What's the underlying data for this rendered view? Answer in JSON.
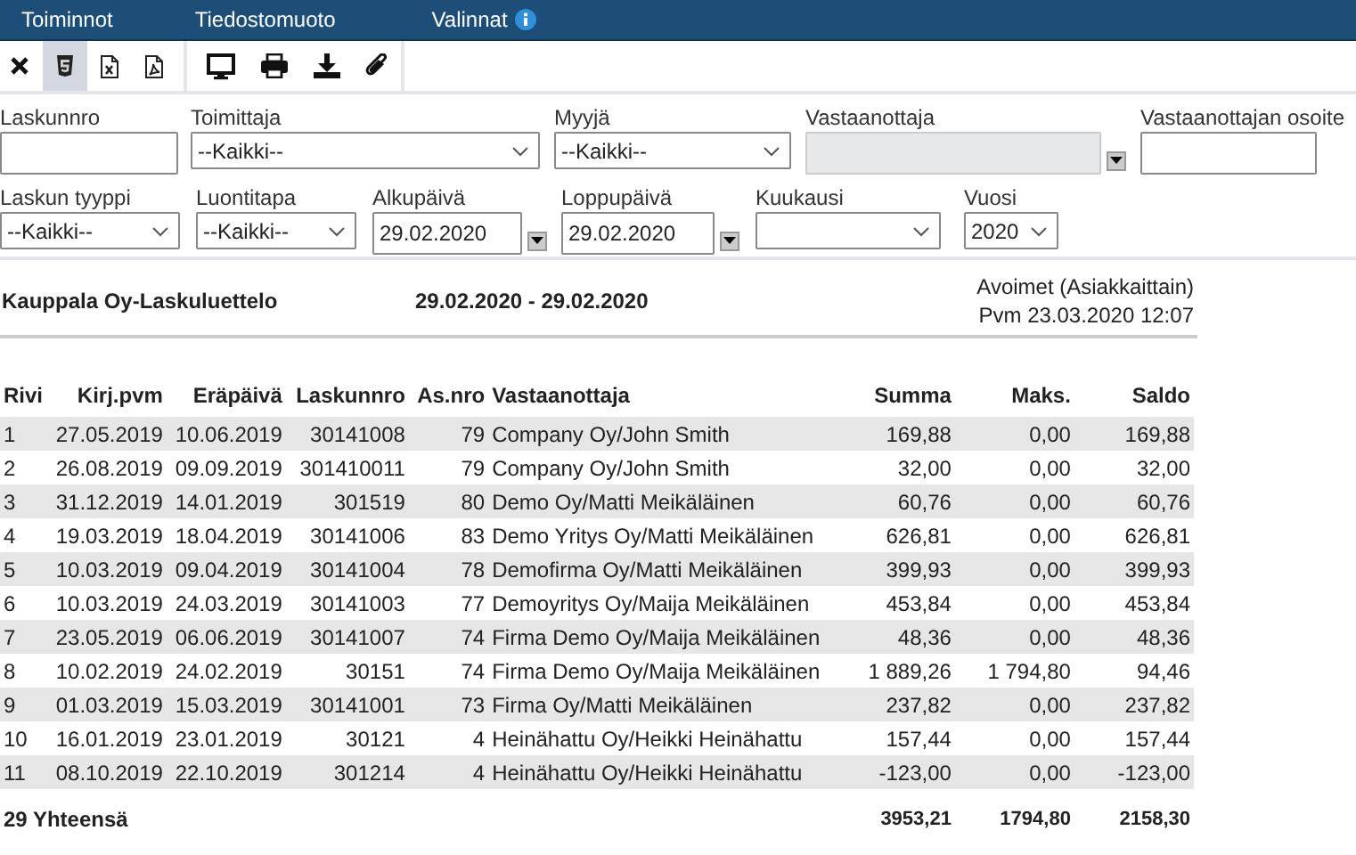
{
  "menu": [
    {
      "label": "Toiminnot",
      "info": false
    },
    {
      "label": "Tiedostomuoto",
      "info": false
    },
    {
      "label": "Valinnat",
      "info": true
    }
  ],
  "toolbar": [
    {
      "kind": "close",
      "selected": false
    },
    {
      "kind": "html",
      "selected": true
    },
    {
      "kind": "excel",
      "selected": false
    },
    {
      "kind": "pdf",
      "selected": false
    },
    {
      "kind": "separator"
    },
    {
      "kind": "monitor",
      "selected": false
    },
    {
      "kind": "print",
      "selected": false
    },
    {
      "kind": "download",
      "selected": false
    },
    {
      "kind": "attach",
      "selected": false
    }
  ],
  "filter_rows": [
    [
      {
        "label": "Laskunnro",
        "kind": "text",
        "disabled": false
      },
      {
        "label": "Toimittaja",
        "kind": "select",
        "value": "--Kaikki--",
        "disabled": false
      },
      {
        "label": "Myyjä",
        "kind": "select",
        "value": "--Kaikki--",
        "disabled": false
      },
      {
        "label": "Vastaanottaja",
        "kind": "combo",
        "disabled": true
      },
      {
        "label": "Vastaanottajan osoite",
        "kind": "text",
        "disabled": false
      }
    ],
    [
      {
        "label": "Laskun tyyppi",
        "kind": "select",
        "value": "--Kaikki--",
        "disabled": false
      },
      {
        "label": "Luontitapa",
        "kind": "select",
        "value": "--Kaikki--",
        "disabled": false
      },
      {
        "label": "Alkupäivä",
        "kind": "combo",
        "value": "29.02.2020",
        "disabled": false
      },
      {
        "label": "Loppupäivä",
        "kind": "combo",
        "value": "29.02.2020",
        "disabled": false
      },
      {
        "label": "Kuukausi",
        "kind": "select",
        "disabled": false
      },
      {
        "label": "Vuosi",
        "kind": "select",
        "value": "2020",
        "disabled": false
      }
    ]
  ],
  "report": {
    "title": "Kauppala Oy-Laskuluettelo",
    "period": "29.02.2020 - 29.02.2020",
    "type": "Avoimet (Asiakkaittain)",
    "printed": "Pvm 23.03.2020 12:07"
  },
  "table": {
    "columns": [
      "Rivi",
      "Kirj.pvm",
      "Eräpäivä",
      "Laskunnro",
      "As.nro",
      "Vastaanottaja",
      "Summa",
      "Maks.",
      "Saldo"
    ],
    "rows": [
      [
        "1",
        "27.05.2019",
        "10.06.2019",
        "30141008",
        "79",
        "Company Oy/John Smith",
        "169,88",
        "0,00",
        "169,88"
      ],
      [
        "2",
        "26.08.2019",
        "09.09.2019",
        "301410011",
        "79",
        "Company Oy/John Smith",
        "32,00",
        "0,00",
        "32,00"
      ],
      [
        "3",
        "31.12.2019",
        "14.01.2019",
        "301519",
        "80",
        "Demo Oy/Matti Meikäläinen",
        "60,76",
        "0,00",
        "60,76"
      ],
      [
        "4",
        "19.03.2019",
        "18.04.2019",
        "30141006",
        "83",
        "Demo Yritys Oy/Matti Meikäläinen",
        "626,81",
        "0,00",
        "626,81"
      ],
      [
        "5",
        "10.03.2019",
        "09.04.2019",
        "30141004",
        "78",
        "Demofirma Oy/Matti Meikäläinen",
        "399,93",
        "0,00",
        "399,93"
      ],
      [
        "6",
        "10.03.2019",
        "24.03.2019",
        "30141003",
        "77",
        "Demoyritys Oy/Maija Meikäläinen",
        "453,84",
        "0,00",
        "453,84"
      ],
      [
        "7",
        "23.05.2019",
        "06.06.2019",
        "30141007",
        "74",
        "Firma Demo Oy/Maija Meikäläinen",
        "48,36",
        "0,00",
        "48,36"
      ],
      [
        "8",
        "10.02.2019",
        "24.02.2019",
        "30151",
        "74",
        "Firma Demo Oy/Maija Meikäläinen",
        "1 889,26",
        "1 794,80",
        "94,46"
      ],
      [
        "9",
        "01.03.2019",
        "15.03.2019",
        "30141001",
        "73",
        "Firma Oy/Matti Meikäläinen",
        "237,82",
        "0,00",
        "237,82"
      ],
      [
        "10",
        "16.01.2019",
        "23.01.2019",
        "30121",
        "4",
        "Heinähattu Oy/Heikki Heinähattu",
        "157,44",
        "0,00",
        "157,44"
      ],
      [
        "11",
        "08.10.2019",
        "22.10.2019",
        "301214",
        "4",
        "Heinähattu Oy/Heikki Heinähattu",
        "-123,00",
        "0,00",
        "-123,00"
      ]
    ],
    "totals": {
      "label": "29 Yhteensä",
      "summa": "3953,21",
      "maks": "1794,80",
      "saldo": "2158,30"
    }
  }
}
